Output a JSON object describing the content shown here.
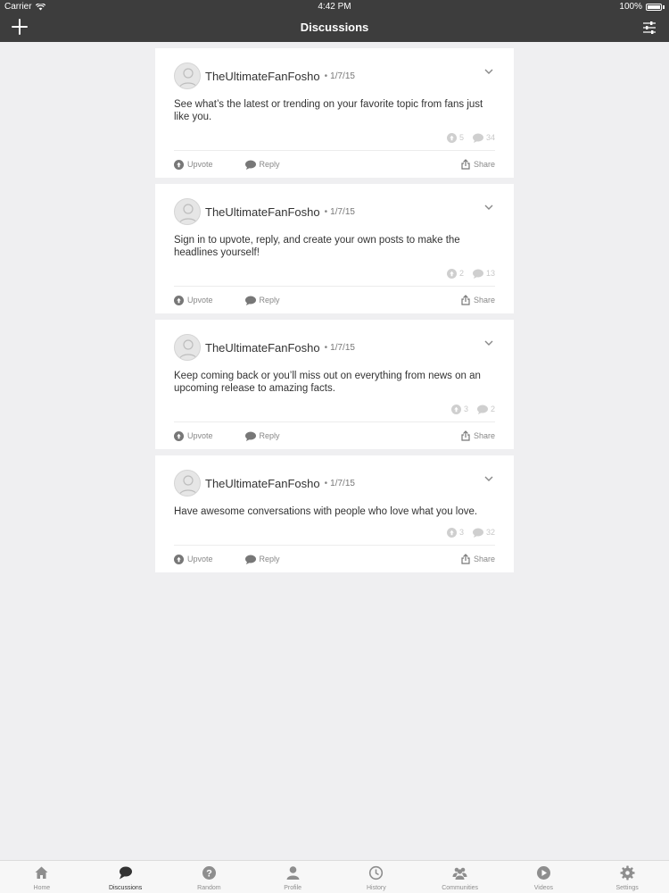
{
  "status_bar": {
    "carrier": "Carrier",
    "time": "4:42 PM",
    "battery": "100%"
  },
  "nav": {
    "title": "Discussions"
  },
  "posts": [
    {
      "author": "TheUltimateFanFosho",
      "separator": "•",
      "date": "1/7/15",
      "text": "See what’s the latest or trending on your favorite topic from fans just like you.",
      "upvotes": "5",
      "replies": "34"
    },
    {
      "author": "TheUltimateFanFosho",
      "separator": "•",
      "date": "1/7/15",
      "text": "Sign in to upvote, reply, and create your own posts to make the headlines yourself!",
      "upvotes": "2",
      "replies": "13"
    },
    {
      "author": "TheUltimateFanFosho",
      "separator": "•",
      "date": "1/7/15",
      "text": "Keep coming back or you’ll miss out on everything from news on an upcoming release to amazing facts.",
      "upvotes": "3",
      "replies": "2"
    },
    {
      "author": "TheUltimateFanFosho",
      "separator": "•",
      "date": "1/7/15",
      "text": "Have awesome conversations with people who love what you love.",
      "upvotes": "3",
      "replies": "32"
    }
  ],
  "actions": {
    "upvote": "Upvote",
    "reply": "Reply",
    "share": "Share"
  },
  "tabs": [
    {
      "label": "Home",
      "icon": "home-icon"
    },
    {
      "label": "Discussions",
      "icon": "discussions-icon",
      "active": true
    },
    {
      "label": "Random",
      "icon": "random-icon"
    },
    {
      "label": "Profile",
      "icon": "profile-icon"
    },
    {
      "label": "History",
      "icon": "history-icon"
    },
    {
      "label": "Communities",
      "icon": "communities-icon"
    },
    {
      "label": "Videos",
      "icon": "videos-icon"
    },
    {
      "label": "Settings",
      "icon": "settings-icon"
    }
  ],
  "colors": {
    "bar": "#3d3d3d",
    "background": "#efeff1",
    "card": "#ffffff"
  }
}
